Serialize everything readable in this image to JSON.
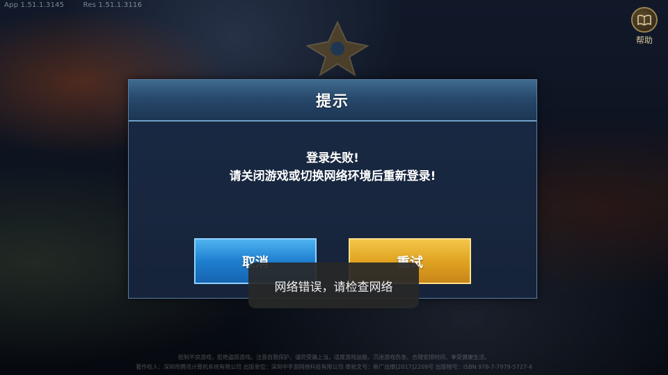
{
  "top_bar": {
    "app_version": "App 1.51.1.3145",
    "res_version": "Res 1.51.1.3116",
    "help_label": "帮助"
  },
  "dialog": {
    "title": "提示",
    "message_line1": "登录失败!",
    "message_line2": "请关闭游戏或切换网络环境后重新登录!",
    "cancel_label": "取消",
    "retry_label": "重试"
  },
  "toast": {
    "text": "网络错误，请检查网络"
  },
  "footer": {
    "line1": "抵制不良游戏，拒绝盗版游戏。注意自我保护，谨防受骗上当。适度游戏益脑，沉迷游戏伤身。合理安排时间，享受健康生活。",
    "line2": "著作权人：深圳市腾讯计算机系统有限公司 出版单位：深圳中手游网络科技有限公司 审批文号：新广出审[2017]2209号 出版物号：ISBN 978-7-7979-5727-4"
  },
  "colors": {
    "cancel_button": "#1f7fd0",
    "retry_button": "#e0a321",
    "dialog_header": "#28496b",
    "toast_bg": "#282828"
  },
  "icons": {
    "help": "book-icon"
  }
}
